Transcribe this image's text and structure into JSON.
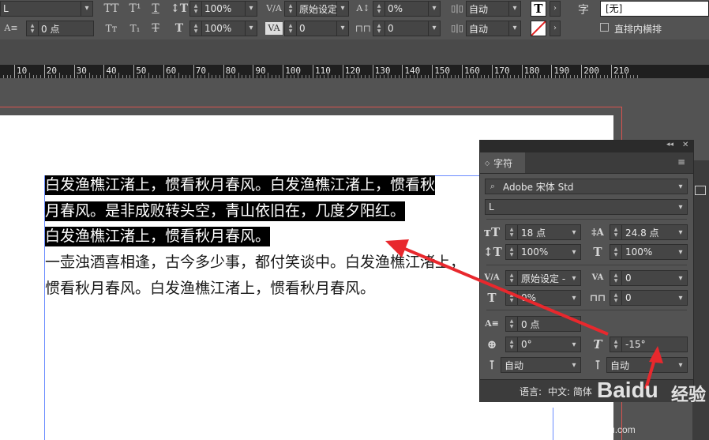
{
  "control_bar": {
    "font_style": "L",
    "tracking_font_style_value": "0 点",
    "vertical_scale": "100%",
    "horizontal_scale": "100%",
    "kerning": "原始设定",
    "tracking": "0",
    "baseline_shift": "0%",
    "char_rotation": "0",
    "auto1": "自动",
    "auto2": "自动",
    "char_style_label": "字",
    "char_style_value": "[无]",
    "vertical_in_horizontal": "直排内横排",
    "icons": [
      "tt-allcaps-icon",
      "tt-superscript-icon",
      "underline-icon",
      "leading-icon",
      "kerning-icon",
      "tracking-icon",
      "baseline-icon",
      "scale-icon",
      "stroke-icon",
      "fill-T-icon"
    ]
  },
  "ruler": {
    "labels": [
      "10",
      "20",
      "30",
      "40",
      "50",
      "60",
      "70",
      "80",
      "90",
      "100",
      "110",
      "120",
      "130",
      "140",
      "150",
      "160",
      "170",
      "180",
      "190",
      "200",
      "210"
    ]
  },
  "document": {
    "lines": [
      {
        "text": "白发渔樵江渚上，惯看秋月春风。白发渔樵江渚上，惯看秋",
        "selected": true
      },
      {
        "text": "月春风。是非成败转头空，青山依旧在，几度夕阳红。",
        "selected": true
      },
      {
        "text": "白发渔樵江渚上，惯看秋月春风。",
        "selected": true
      },
      {
        "text": "一壶浊酒喜相逢，古今多少事，都付笑谈中。白发渔樵江渚上，",
        "selected": false
      },
      {
        "text": "惯看秋月春风。白发渔樵江渚上，惯看秋月春风。",
        "selected": false
      }
    ]
  },
  "panel": {
    "collapse_glyph": "◂◂",
    "close_glyph": "✕",
    "tab_label": "字符",
    "font_family": "Adobe 宋体 Std",
    "font_style": "L",
    "font_size": "18 点",
    "leading": "24.8 点",
    "vertical_scale": "100%",
    "horizontal_scale": "100%",
    "kerning": "原始设定 -",
    "tracking": "0",
    "tsume": "0%",
    "grid_tracking": "0",
    "aki": "0 点",
    "rotation": "0°",
    "skew": "-15°",
    "auto_left": "自动",
    "auto_right": "自动",
    "language_label": "语言:",
    "language_value": "中文: 简体"
  },
  "watermark": {
    "brand": "Baidu",
    "brand_suffix": "经验",
    "url": "jingyan.baidu.com"
  },
  "colors": {
    "annotation_arrow": "#e8282d",
    "selection": "#000000",
    "page_edge": "#d9534f"
  }
}
